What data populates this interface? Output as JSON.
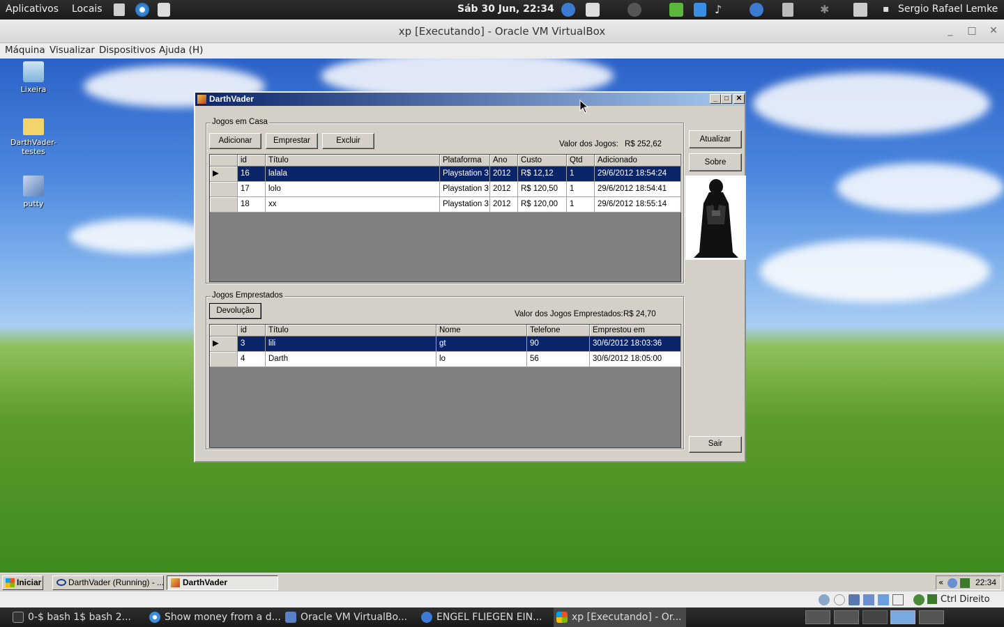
{
  "top_panel": {
    "apps": "Aplicativos",
    "places": "Locais",
    "clock": "Sáb 30 Jun, 22:34",
    "user": "Sergio Rafael Lemke"
  },
  "vbox": {
    "title": "xp [Executando] - Oracle VM VirtualBox",
    "menu": [
      "Máquina",
      "Visualizar",
      "Dispositivos",
      "Ajuda (H)"
    ],
    "status_key": "Ctrl Direito"
  },
  "desktop_icons": [
    "Lixeira",
    "DarthVader-testes",
    "putty"
  ],
  "app": {
    "title": "DarthVader",
    "home_group": "Jogos em Casa",
    "btn_add": "Adicionar",
    "btn_lend": "Emprestar",
    "btn_delete": "Excluir",
    "value_label": "Valor dos Jogos:",
    "value": "R$ 252,62",
    "btn_update": "Atualizar",
    "btn_about": "Sobre",
    "btn_exit": "Sair",
    "home_columns": [
      "id",
      "Título",
      "Plataforma",
      "Ano",
      "Custo",
      "Qtd",
      "Adicionado"
    ],
    "home_rows": [
      [
        "16",
        "lalala",
        "Playstation 3",
        "2012",
        "R$ 12,12",
        "1",
        "29/6/2012 18:54:24"
      ],
      [
        "17",
        "lolo",
        "Playstation 3",
        "2012",
        "R$ 120,50",
        "1",
        "29/6/2012 18:54:41"
      ],
      [
        "18",
        "xx",
        "Playstation 3",
        "2012",
        "R$ 120,00",
        "1",
        "29/6/2012 18:55:14"
      ]
    ],
    "lent_group": "Jogos Emprestados",
    "btn_return": "Devolução",
    "lent_value_label": "Valor dos Jogos Emprestados:",
    "lent_value": "R$ 24,70",
    "lent_columns": [
      "id",
      "Título",
      "Nome",
      "Telefone",
      "Emprestou em"
    ],
    "lent_rows": [
      [
        "3",
        "lili",
        "gt",
        "90",
        "30/6/2012 18:03:36"
      ],
      [
        "4",
        "Darth",
        "lo",
        "56",
        "30/6/2012 18:05:00"
      ]
    ]
  },
  "xp_taskbar": {
    "start": "Iniciar",
    "tasks": [
      "DarthVader (Running) - ...",
      "DarthVader"
    ],
    "clock": "22:34"
  },
  "bottom_panel": {
    "tasks": [
      "0-$ bash  1$ bash  2...",
      "Show money from a d...",
      "Oracle VM VirtualBo...",
      "ENGEL FLIEGEN EIN...",
      "xp [Executando] - Or..."
    ]
  },
  "colors": {
    "selection": "#0a246a",
    "xp_face": "#d4d0c8"
  }
}
